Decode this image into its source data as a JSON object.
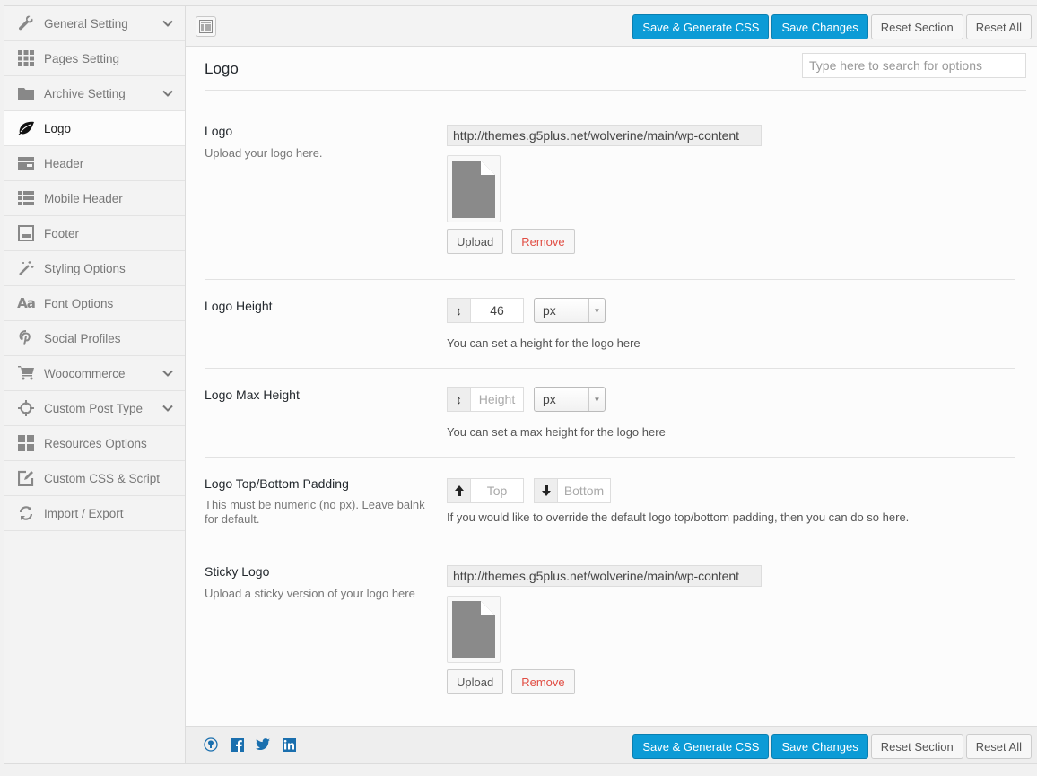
{
  "sidebar": {
    "items": [
      {
        "label": "General Setting",
        "icon": "wrench-icon",
        "has_children": true,
        "active": false
      },
      {
        "label": "Pages Setting",
        "icon": "grid-icon",
        "has_children": false,
        "active": false
      },
      {
        "label": "Archive Setting",
        "icon": "folder-icon",
        "has_children": true,
        "active": false
      },
      {
        "label": "Logo",
        "icon": "leaf-icon",
        "has_children": false,
        "active": true
      },
      {
        "label": "Header",
        "icon": "header-icon",
        "has_children": false,
        "active": false
      },
      {
        "label": "Mobile Header",
        "icon": "list-icon",
        "has_children": false,
        "active": false
      },
      {
        "label": "Footer",
        "icon": "footer-icon",
        "has_children": false,
        "active": false
      },
      {
        "label": "Styling Options",
        "icon": "magic-wand-icon",
        "has_children": false,
        "active": false
      },
      {
        "label": "Font Options",
        "icon": "font-icon",
        "has_children": false,
        "active": false
      },
      {
        "label": "Social Profiles",
        "icon": "pinterest-icon",
        "has_children": false,
        "active": false
      },
      {
        "label": "Woocommerce",
        "icon": "cart-icon",
        "has_children": true,
        "active": false
      },
      {
        "label": "Custom Post Type",
        "icon": "crosshair-icon",
        "has_children": true,
        "active": false
      },
      {
        "label": "Resources Options",
        "icon": "dashboard-icon",
        "has_children": false,
        "active": false
      },
      {
        "label": "Custom CSS & Script",
        "icon": "edit-icon",
        "has_children": false,
        "active": false
      },
      {
        "label": "Import / Export",
        "icon": "refresh-icon",
        "has_children": false,
        "active": false
      }
    ]
  },
  "toolbar": {
    "save_generate_label": "Save & Generate CSS",
    "save_changes_label": "Save Changes",
    "reset_section_label": "Reset Section",
    "reset_all_label": "Reset All"
  },
  "section": {
    "title": "Logo",
    "search_placeholder": "Type here to search for options"
  },
  "fields": {
    "logo": {
      "label": "Logo",
      "desc": "Upload your logo here.",
      "url": "http://themes.g5plus.net/wolverine/main/wp-content",
      "upload_label": "Upload",
      "remove_label": "Remove"
    },
    "logo_height": {
      "label": "Logo Height",
      "value": "46",
      "unit": "px",
      "help": "You can set a height for the logo here"
    },
    "logo_max_height": {
      "label": "Logo Max Height",
      "placeholder": "Height",
      "unit": "px",
      "help": "You can set a max height for the logo here"
    },
    "logo_padding": {
      "label": "Logo Top/Bottom Padding",
      "desc": "This must be numeric (no px). Leave balnk for default.",
      "top_placeholder": "Top",
      "bottom_placeholder": "Bottom",
      "help": "If you would like to override the default logo top/bottom padding, then you can do so here."
    },
    "sticky_logo": {
      "label": "Sticky Logo",
      "desc": "Upload a sticky version of your logo here",
      "url": "http://themes.g5plus.net/wolverine/main/wp-content",
      "upload_label": "Upload",
      "remove_label": "Remove"
    }
  },
  "footer": {
    "social": [
      "github-icon",
      "facebook-icon",
      "twitter-icon",
      "linkedin-icon"
    ]
  },
  "colors": {
    "primary": "#0c9bd6",
    "remove": "#e14d43",
    "social": "#1a6fae"
  }
}
